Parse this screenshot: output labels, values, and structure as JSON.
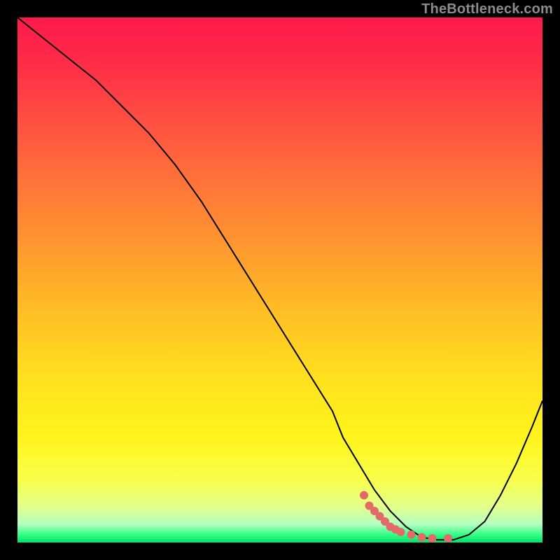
{
  "watermark": "TheBottleneck.com",
  "chart_data": {
    "type": "line",
    "title": "",
    "xlabel": "",
    "ylabel": "",
    "xlim": [
      0,
      100
    ],
    "ylim": [
      0,
      100
    ],
    "grid": false,
    "legend": false,
    "background_gradient": {
      "stops": [
        {
          "offset": 0.0,
          "color": "#ff1a4b"
        },
        {
          "offset": 0.08,
          "color": "#ff2a48"
        },
        {
          "offset": 0.18,
          "color": "#ff4a42"
        },
        {
          "offset": 0.3,
          "color": "#ff6f3a"
        },
        {
          "offset": 0.42,
          "color": "#ff9330"
        },
        {
          "offset": 0.55,
          "color": "#ffbb25"
        },
        {
          "offset": 0.68,
          "color": "#ffdf1e"
        },
        {
          "offset": 0.8,
          "color": "#fff41c"
        },
        {
          "offset": 0.88,
          "color": "#f8ff4a"
        },
        {
          "offset": 0.93,
          "color": "#e4ff8a"
        },
        {
          "offset": 0.965,
          "color": "#b4ffc0"
        },
        {
          "offset": 0.985,
          "color": "#34ff85"
        },
        {
          "offset": 1.0,
          "color": "#00e06a"
        }
      ]
    },
    "series": [
      {
        "name": "bottleneck-curve",
        "color": "#000000",
        "width": 2,
        "x": [
          0,
          5,
          10,
          15,
          20,
          25,
          30,
          35,
          40,
          45,
          50,
          55,
          60,
          62,
          65,
          68,
          71,
          74,
          77,
          80,
          83,
          86,
          89,
          92,
          95,
          98,
          100
        ],
        "y": [
          100,
          96,
          92,
          88,
          83,
          78,
          72,
          65,
          57,
          49,
          41,
          33,
          25,
          20,
          15,
          10,
          6,
          3,
          1,
          0.5,
          0.5,
          1.5,
          4,
          9,
          15,
          22,
          27
        ]
      }
    ],
    "markers": [
      {
        "name": "highlight-dots",
        "color": "#e46a6a",
        "radius_px": 6,
        "x": [
          66,
          67,
          68,
          69,
          70,
          71,
          72,
          73,
          75,
          77,
          79,
          82
        ],
        "y": [
          9,
          7,
          6,
          5,
          4,
          3,
          2.5,
          2,
          1.5,
          1,
          0.8,
          0.8
        ]
      }
    ]
  }
}
